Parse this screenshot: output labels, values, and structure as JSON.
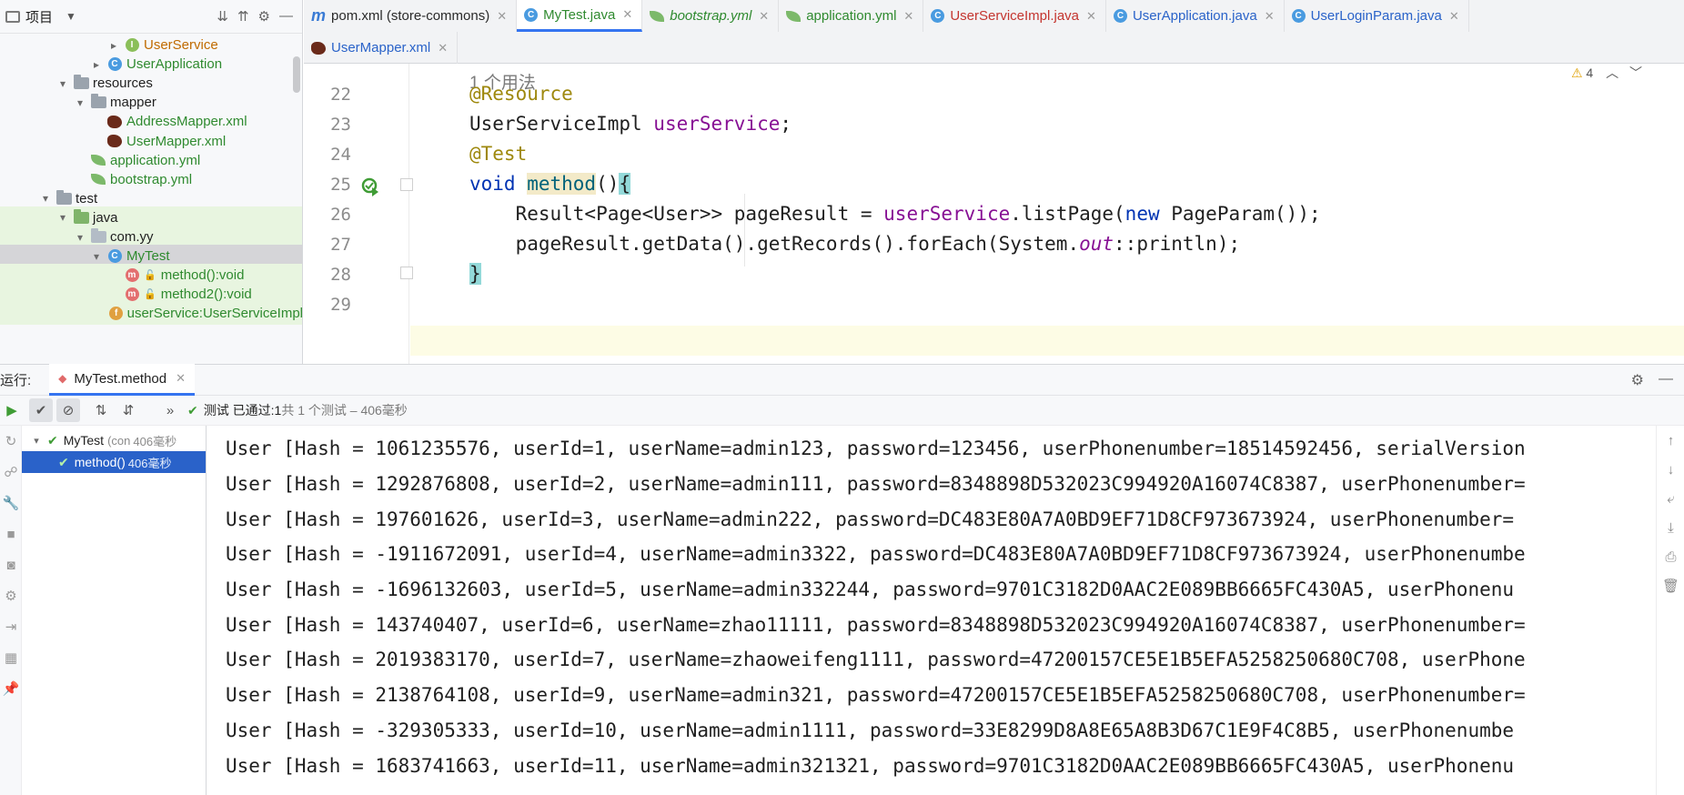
{
  "project_panel": {
    "title": "项目",
    "tree": [
      {
        "label": "UserService",
        "icon": "interface-icon",
        "color": "orange",
        "indent": 0,
        "arrow": "›"
      },
      {
        "label": "UserApplication",
        "icon": "class-icon",
        "color": "green",
        "indent": 0,
        "arrow": "›"
      },
      {
        "label": "resources",
        "icon": "folder-icon",
        "color": "dark",
        "indent": 0,
        "arrow": "⌄"
      },
      {
        "label": "mapper",
        "icon": "folder-icon",
        "color": "dark",
        "indent": 1,
        "arrow": "⌄"
      },
      {
        "label": "AddressMapper.xml",
        "icon": "mybatis-icon",
        "color": "green",
        "indent": 2,
        "arrow": ""
      },
      {
        "label": "UserMapper.xml",
        "icon": "mybatis-icon",
        "color": "green",
        "indent": 2,
        "arrow": ""
      },
      {
        "label": "application.yml",
        "icon": "yml-icon",
        "color": "green",
        "indent": 1,
        "arrow": ""
      },
      {
        "label": "bootstrap.yml",
        "icon": "yml-icon",
        "color": "green",
        "indent": 1,
        "arrow": ""
      },
      {
        "label": "test",
        "icon": "folder-icon",
        "color": "dark",
        "indent": 0,
        "arrow": "⌄"
      },
      {
        "label": "java",
        "icon": "folder-icon",
        "color": "dark",
        "indent": 0,
        "arrow": "⌄"
      },
      {
        "label": "com.yy",
        "icon": "package-icon",
        "color": "dark",
        "indent": 0,
        "arrow": "⌄"
      },
      {
        "label": "MyTest",
        "icon": "class-icon",
        "color": "green",
        "indent": 0,
        "arrow": "⌄"
      },
      {
        "label": "method():void",
        "icon": "method-icon",
        "color": "green",
        "indent": 0,
        "arrow": ""
      },
      {
        "label": "method2():void",
        "icon": "method-icon",
        "color": "green",
        "indent": 0,
        "arrow": ""
      },
      {
        "label": "userService:UserServiceImpl",
        "icon": "field-icon",
        "color": "green",
        "indent": 0,
        "arrow": ""
      }
    ]
  },
  "editor_tabs": {
    "row1": [
      {
        "label": "pom.xml (store-commons)",
        "icon": "maven-icon",
        "active": false,
        "style": "dark"
      },
      {
        "label": "MyTest.java",
        "icon": "class-icon",
        "active": true,
        "style": "green"
      },
      {
        "label": "bootstrap.yml",
        "icon": "yml-icon",
        "active": false,
        "style": "green-italic"
      },
      {
        "label": "application.yml",
        "icon": "yml-icon",
        "active": false,
        "style": "green"
      },
      {
        "label": "UserServiceImpl.java",
        "icon": "class-icon",
        "active": false,
        "style": "red"
      },
      {
        "label": "UserApplication.java",
        "icon": "class-icon",
        "active": false,
        "style": "blue"
      },
      {
        "label": "UserLoginParam.java",
        "icon": "class-icon",
        "active": false,
        "style": "blue"
      }
    ],
    "row2": [
      {
        "label": "UserMapper.xml",
        "icon": "mybatis-icon",
        "active": false,
        "style": "blue"
      }
    ]
  },
  "editor": {
    "usage_hint": "1 个用法",
    "warning_count": "4",
    "lines": [
      {
        "num": "22"
      },
      {
        "num": "23"
      },
      {
        "num": "24"
      },
      {
        "num": "25"
      },
      {
        "num": "26"
      },
      {
        "num": "27"
      },
      {
        "num": "28"
      },
      {
        "num": "29"
      }
    ],
    "code": {
      "l22": "@Resource",
      "l23_type": "UserServiceImpl ",
      "l23_field": "userService",
      "l23_end": ";",
      "l24": "@Test",
      "l25_kw": "void ",
      "l25_method": "method",
      "l25_paren": "()",
      "l25_brace": "{",
      "l26_a": "    Result<Page<User>> pageResult = ",
      "l26_field": "userService",
      "l26_b": ".listPage(",
      "l26_kw": "new",
      "l26_c": " PageParam());",
      "l27_a": "    pageResult.getData().getRecords().forEach(System.",
      "l27_out": "out",
      "l27_b": "::println);",
      "l28": "}"
    }
  },
  "run_panel": {
    "label": "运行:",
    "tab": "MyTest.method",
    "status_prefix": "测试 已通过: ",
    "status_count": "1",
    "status_suffix": "共 1 个测试 – 406毫秒",
    "test_tree": [
      {
        "name": "MyTest",
        "detail": "(con",
        "time": "406毫秒",
        "selected": false
      },
      {
        "name": "method()",
        "detail": "",
        "time": "406毫秒",
        "selected": true
      }
    ],
    "console": [
      "User [Hash = 1061235576, userId=1, userName=admin123, password=123456, userPhonenumber=18514592456, serialVersion",
      "User [Hash = 1292876808, userId=2, userName=admin111, password=8348898D532023C994920A16074C8387, userPhonenumber=",
      "User [Hash = 197601626, userId=3, userName=admin222, password=DC483E80A7A0BD9EF71D8CF973673924, userPhonenumber=",
      "User [Hash = -1911672091, userId=4, userName=admin3322, password=DC483E80A7A0BD9EF71D8CF973673924, userPhonenumbe",
      "User [Hash = -1696132603, userId=5, userName=admin332244, password=9701C3182D0AAC2E089BB6665FC430A5, userPhonenu",
      "User [Hash = 143740407, userId=6, userName=zhao11111, password=8348898D532023C994920A16074C8387, userPhonenumber=",
      "User [Hash = 2019383170, userId=7, userName=zhaoweifeng1111, password=47200157CE5E1B5EFA5258250680C708, userPhone",
      "User [Hash = 2138764108, userId=9, userName=admin321, password=47200157CE5E1B5EFA5258250680C708, userPhonenumber=",
      "User [Hash = -329305333, userId=10, userName=admin1111, password=33E8299D8A8E65A8B3D67C1E9F4C8B5, userPhonenumbe",
      "User [Hash = 1683741663, userId=11, userName=admin321321, password=9701C3182D0AAC2E089BB6665FC430A5, userPhonenu"
    ]
  }
}
